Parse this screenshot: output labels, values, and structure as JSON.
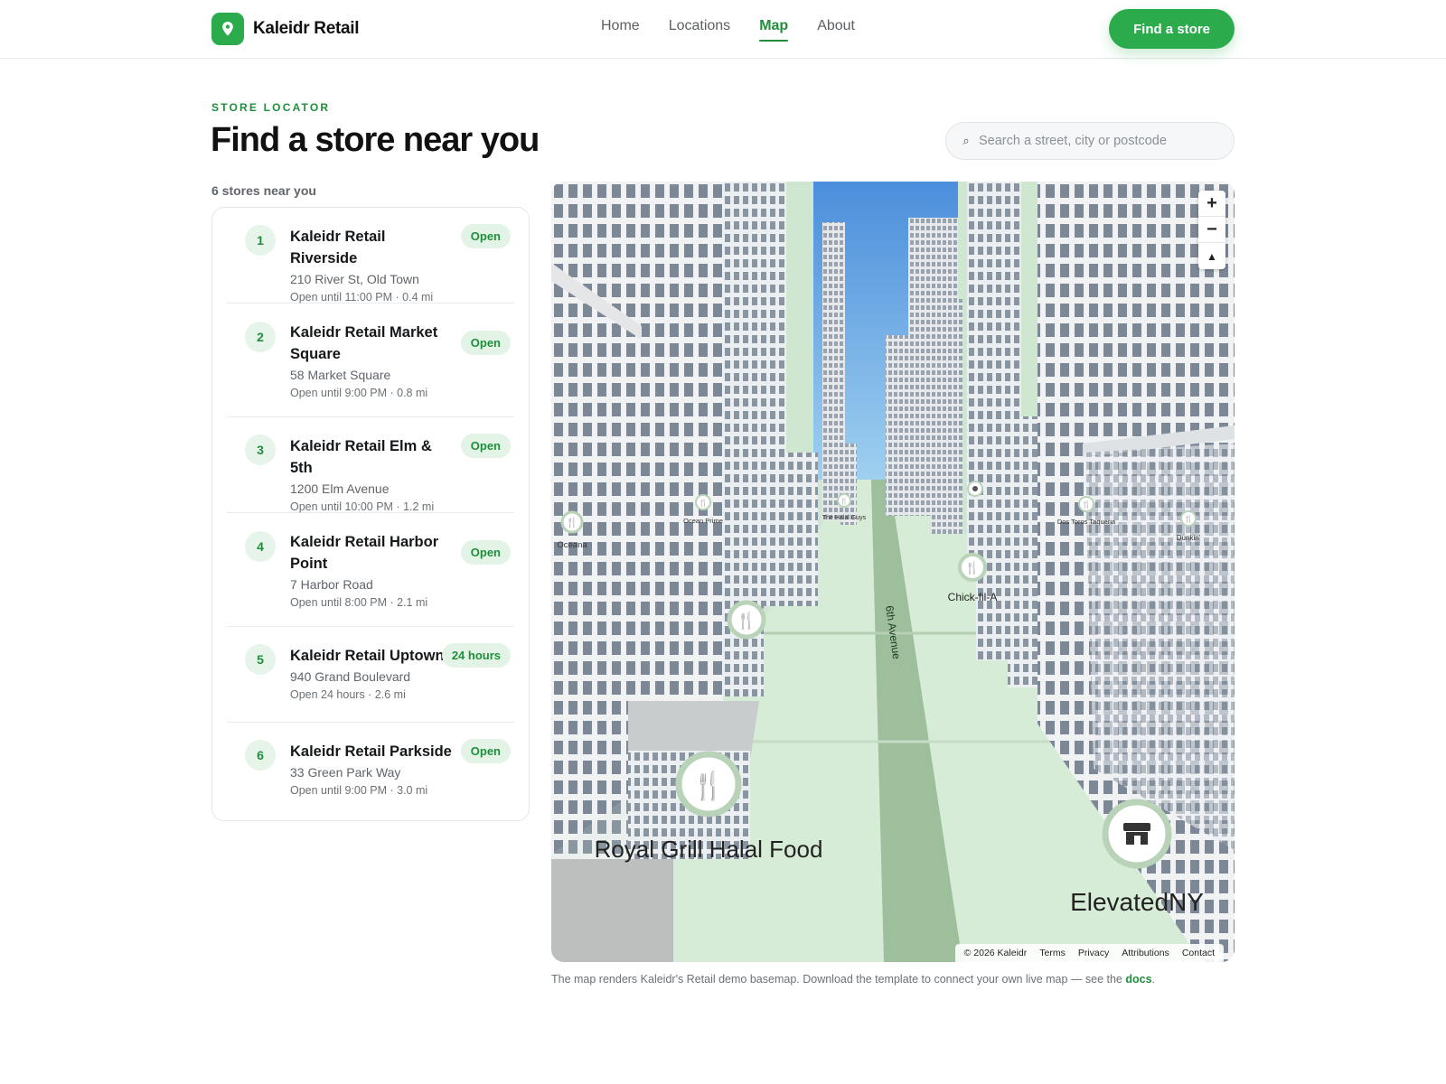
{
  "brand": {
    "name": "Kaleidr Retail",
    "logo_icon": "map-pin-icon"
  },
  "nav": {
    "items": [
      "Home",
      "Locations",
      "Map",
      "About"
    ],
    "active": "Map"
  },
  "cta_label": "Find a store",
  "hero": {
    "eyebrow": "STORE LOCATOR",
    "title": "Find a store near you"
  },
  "search": {
    "placeholder": "Search a street, city or postcode",
    "icon": "search-icon"
  },
  "count_label": "6 stores near you",
  "stores": [
    {
      "num": "1",
      "name": "Kaleidr Retail Riverside",
      "address": "210 River St, Old Town",
      "meta": "Open until 11:00 PM · 0.4 mi",
      "badge": "Open"
    },
    {
      "num": "2",
      "name": "Kaleidr Retail Market Square",
      "address": "58 Market Square",
      "meta": "Open until 9:00 PM · 0.8 mi",
      "badge": "Open"
    },
    {
      "num": "3",
      "name": "Kaleidr Retail Elm & 5th",
      "address": "1200 Elm Avenue",
      "meta": "Open until 10:00 PM · 1.2 mi",
      "badge": "Open"
    },
    {
      "num": "4",
      "name": "Kaleidr Retail Harbor Point",
      "address": "7 Harbor Road",
      "meta": "Open until 8:00 PM · 2.1 mi",
      "badge": "Open"
    },
    {
      "num": "5",
      "name": "Kaleidr Retail Uptown",
      "address": "940 Grand Boulevard",
      "meta": "Open 24 hours · 2.6 mi",
      "badge": "24 hours"
    },
    {
      "num": "6",
      "name": "Kaleidr Retail Parkside",
      "address": "33 Green Park Way",
      "meta": "Open until 9:00 PM · 3.0 mi",
      "badge": "Open"
    }
  ],
  "map": {
    "zoom_in": "+",
    "zoom_out": "−",
    "compass": "▲",
    "street_label": "6th Avenue",
    "pois": [
      "Oceana",
      "Ocean Prime",
      "The Halal Guys",
      "Chick-fil-A",
      "Dos Toros Taqueria",
      "Dunkin'",
      "Royal Grill Halal Food",
      "ElevatedNY"
    ],
    "attribution": {
      "copyright": "© 2026 Kaleidr",
      "links": [
        "Terms",
        "Privacy",
        "Attributions",
        "Contact"
      ]
    }
  },
  "footnote": {
    "text": "The map renders Kaleidr's Retail demo basemap. Download the template to connect your own live map — see the ",
    "link": "docs",
    "end": "."
  },
  "colors": {
    "accent": "#2bab4c",
    "accent_dark": "#1f8f3c",
    "badge_bg": "#e3f3e6",
    "road": "#cfe6d0"
  }
}
